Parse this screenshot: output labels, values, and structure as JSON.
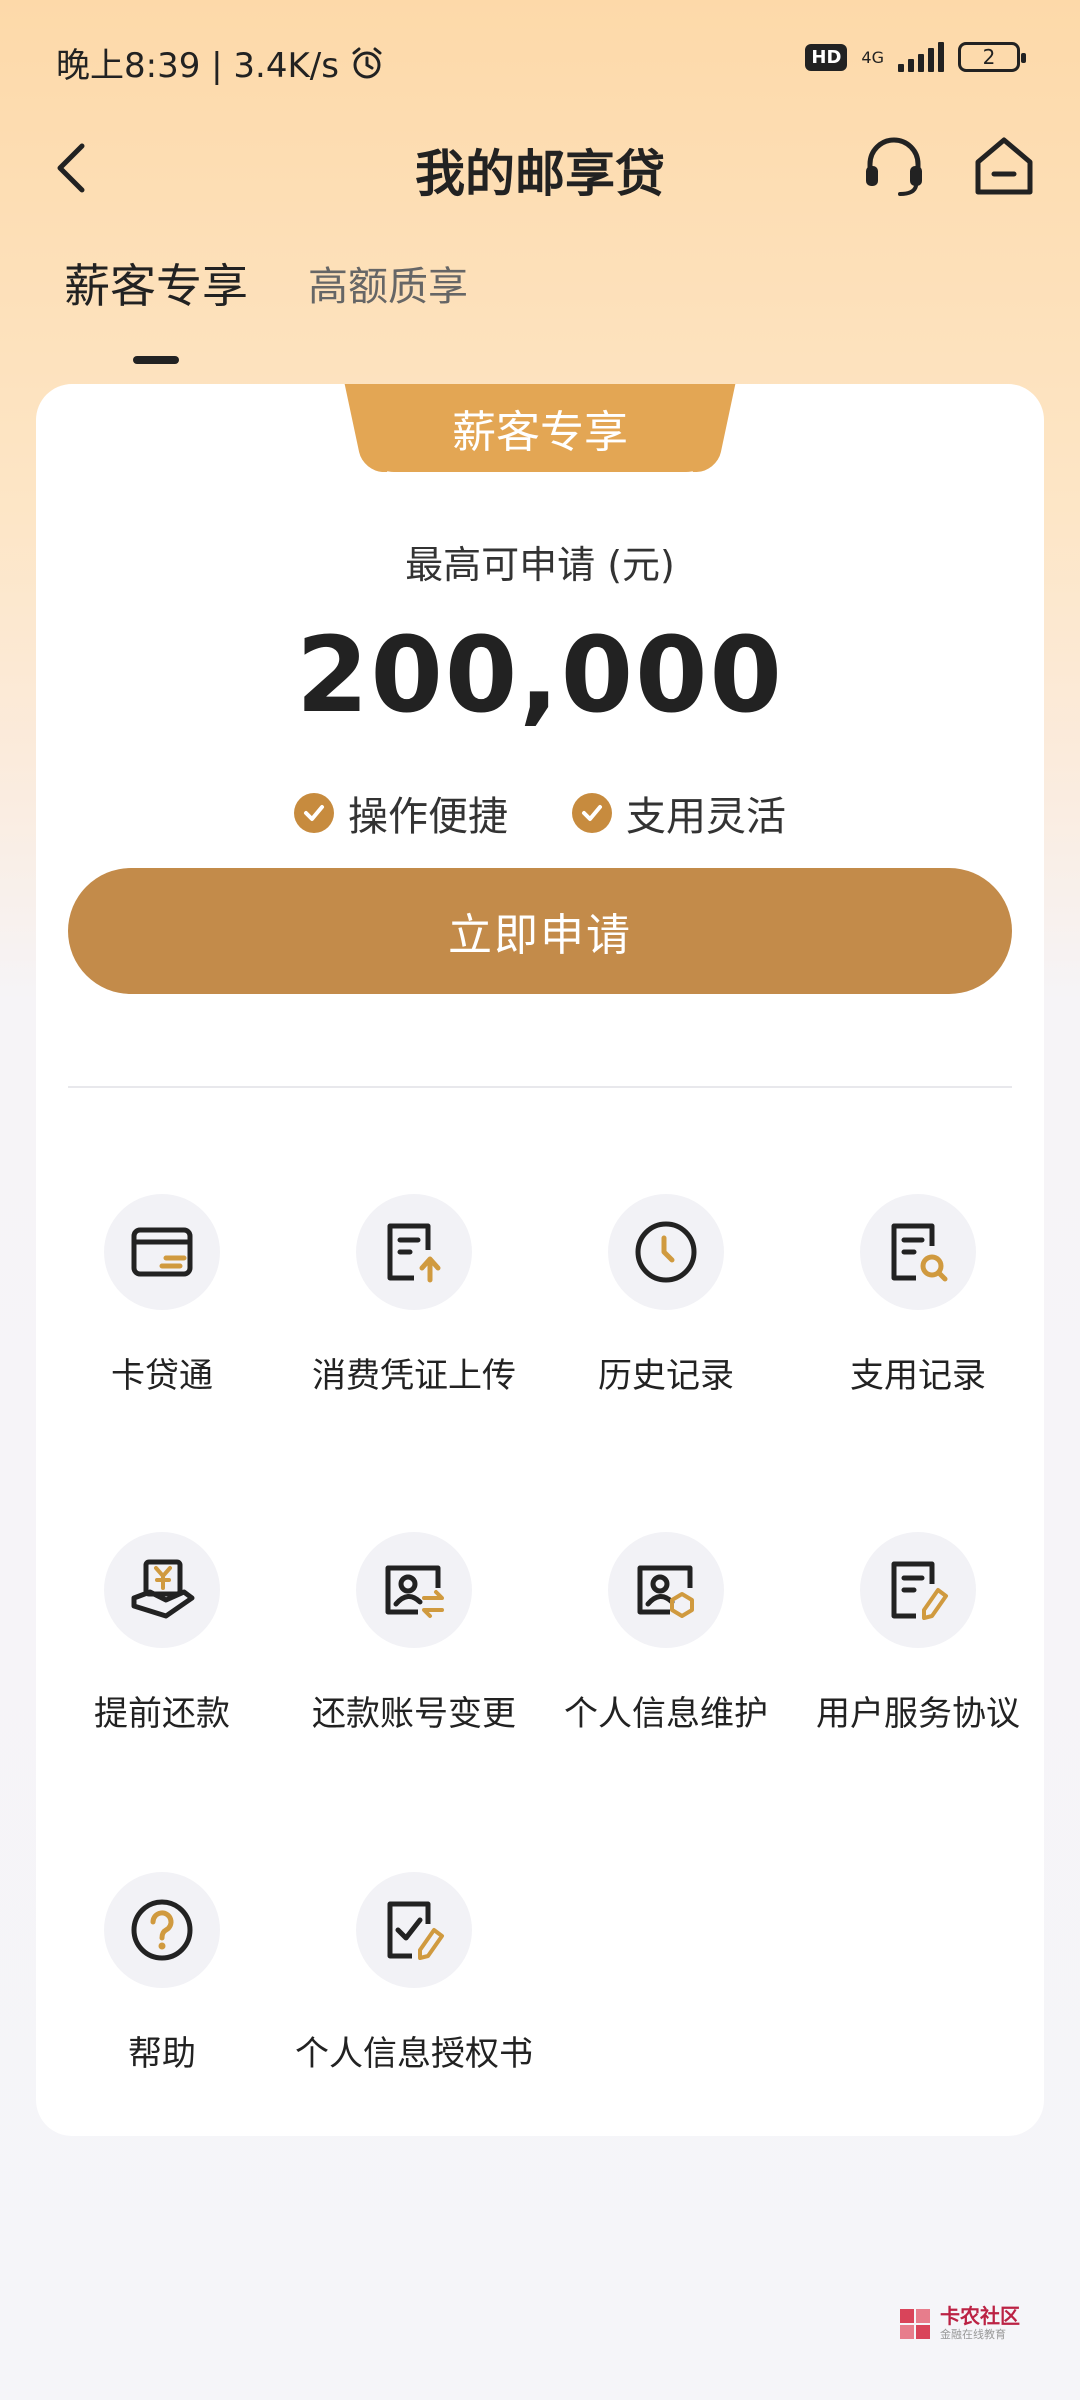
{
  "status_bar": {
    "time_speed": "晚上8:39 | 3.4K/s",
    "hd": "HD",
    "network": "4G",
    "battery": "2"
  },
  "header": {
    "title": "我的邮享贷"
  },
  "tabs": [
    {
      "label": "薪客专享",
      "active": true
    },
    {
      "label": "高额质享",
      "active": false
    }
  ],
  "card": {
    "badge": "薪客专享",
    "limit_label": "最高可申请 (元)",
    "limit_amount": "200,000",
    "features": [
      "操作便捷",
      "支用灵活"
    ],
    "apply_label": "立即申请"
  },
  "grid": [
    {
      "label": "卡贷通",
      "icon": "card-icon"
    },
    {
      "label": "消费凭证上传",
      "icon": "upload-document-icon"
    },
    {
      "label": "历史记录",
      "icon": "clock-icon"
    },
    {
      "label": "支用记录",
      "icon": "document-search-icon"
    },
    {
      "label": "提前还款",
      "icon": "repay-hand-icon"
    },
    {
      "label": "还款账号变更",
      "icon": "account-change-icon"
    },
    {
      "label": "个人信息维护",
      "icon": "profile-edit-icon"
    },
    {
      "label": "用户服务协议",
      "icon": "agreement-pen-icon"
    },
    {
      "label": "帮助",
      "icon": "help-icon"
    },
    {
      "label": "个人信息授权书",
      "icon": "authorization-icon"
    }
  ],
  "watermark": {
    "text": "卡农社区",
    "sub": "金融在线教育"
  },
  "colors": {
    "accent": "#C38B4A",
    "badge": "#E3A654",
    "icon_accent": "#D09A3F",
    "text": "#222222"
  }
}
